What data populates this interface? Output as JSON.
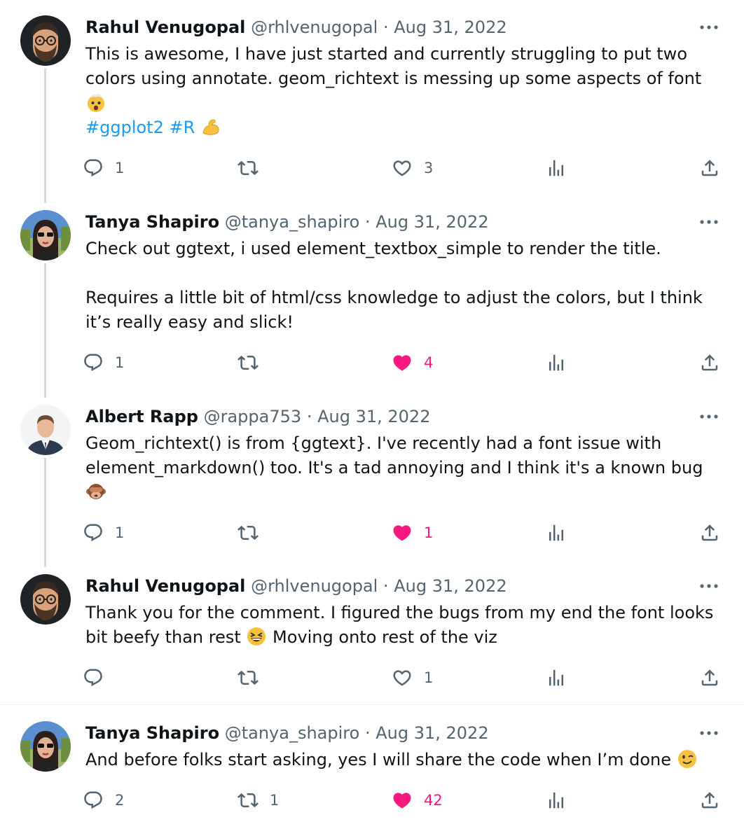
{
  "colors": {
    "text": "#0f1419",
    "secondary": "#536471",
    "link": "#1d9bf0",
    "like": "#f91880",
    "thread_line": "#cfd9de"
  },
  "tweets": [
    {
      "name": "Rahul Venugopal",
      "handle": "@rhlvenugopal",
      "sep": "·",
      "date": "Aug 31, 2022",
      "avatar": "bearded-man-glasses-avatar",
      "line1": "This is awesome, I have just started and currently struggling to put two",
      "line2": "colors using annotate. geom_richtext is messing up some aspects of font",
      "emoji1": "exploding-head-emoji",
      "hashtag1": "#ggplot2",
      "hashtag2": "#R",
      "emoji2": "flexed-biceps-emoji",
      "replies": "1",
      "retweets": "",
      "likes": "3",
      "liked": false
    },
    {
      "name": "Tanya Shapiro",
      "handle": "@tanya_shapiro",
      "sep": "·",
      "date": "Aug 31, 2022",
      "avatar": "woman-sunglasses-avatar",
      "line1": "Check out ggtext, i used element_textbox_simple to render the title.",
      "line2": "Requires a little bit of html/css knowledge to adjust the colors, but I think",
      "line3": "it’s really easy and slick!",
      "replies": "1",
      "retweets": "",
      "likes": "4",
      "liked": true
    },
    {
      "name": "Albert Rapp",
      "handle": "@rappa753",
      "sep": "·",
      "date": "Aug 31, 2022",
      "avatar": "man-suit-avatar",
      "line1": "Geom_richtext() is from {ggtext}. I've recently had a font issue with",
      "line2": "element_markdown() too. It's a tad annoying and I think it's a known bug",
      "emoji1": "see-no-evil-monkey-emoji",
      "replies": "1",
      "retweets": "",
      "likes": "1",
      "liked": true
    },
    {
      "name": "Rahul Venugopal",
      "handle": "@rhlvenugopal",
      "sep": "·",
      "date": "Aug 31, 2022",
      "avatar": "bearded-man-glasses-avatar",
      "line1": "Thank you for the comment. I figured the bugs from my end the font looks",
      "line2a": "bit beefy than rest",
      "emoji1": "grinning-squinting-face-emoji",
      "line2b": "Moving onto rest of the viz",
      "replies": "",
      "retweets": "",
      "likes": "1",
      "liked": false
    },
    {
      "name": "Tanya Shapiro",
      "handle": "@tanya_shapiro",
      "sep": "·",
      "date": "Aug 31, 2022",
      "avatar": "woman-sunglasses-avatar",
      "line1": "And before folks start asking, yes I will share the code when I’m done",
      "emoji1": "winking-face-emoji",
      "replies": "2",
      "retweets": "1",
      "likes": "42",
      "liked": true
    }
  ]
}
